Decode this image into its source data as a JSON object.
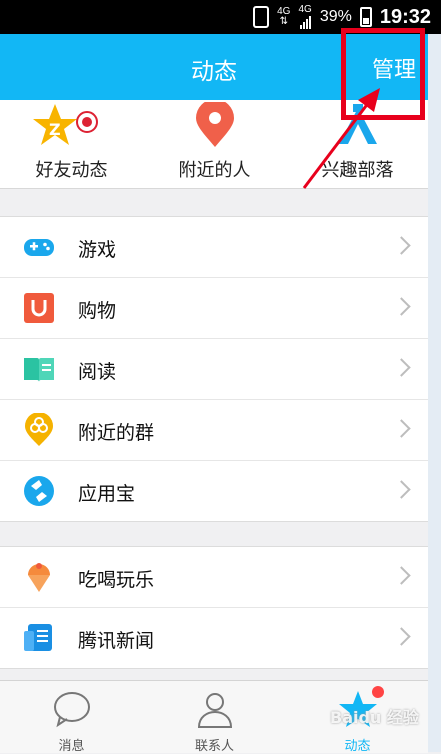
{
  "status_bar": {
    "network_top": "4G",
    "network_small": "4G",
    "battery": "39%",
    "time": "19:32"
  },
  "header": {
    "title": "动态",
    "manage": "管理"
  },
  "top_tabs": [
    {
      "label": "好友动态",
      "icon": "friends-star-icon"
    },
    {
      "label": "附近的人",
      "icon": "location-pin-icon"
    },
    {
      "label": "兴趣部落",
      "icon": "tribe-icon"
    }
  ],
  "group1": [
    {
      "label": "游戏",
      "icon": "gamepad-icon",
      "color": "#1aa7ec"
    },
    {
      "label": "购物",
      "icon": "shopping-bag-icon",
      "color": "#f05a3c"
    },
    {
      "label": "阅读",
      "icon": "book-icon",
      "color": "#2bc3a2"
    },
    {
      "label": "附近的群",
      "icon": "nearby-group-icon",
      "color": "#f5b200"
    },
    {
      "label": "应用宝",
      "icon": "app-store-icon",
      "color": "#1aa7ec"
    }
  ],
  "group2": [
    {
      "label": "吃喝玩乐",
      "icon": "icecream-icon",
      "color": "#f58a3c"
    },
    {
      "label": "腾讯新闻",
      "icon": "news-icon",
      "color": "#1a8fe3"
    }
  ],
  "bottom_tabs": [
    {
      "label": "消息",
      "icon": "message-bubble-icon"
    },
    {
      "label": "联系人",
      "icon": "contacts-icon"
    },
    {
      "label": "动态",
      "icon": "star-icon",
      "active": true
    }
  ],
  "watermark": "Baidu 经验"
}
